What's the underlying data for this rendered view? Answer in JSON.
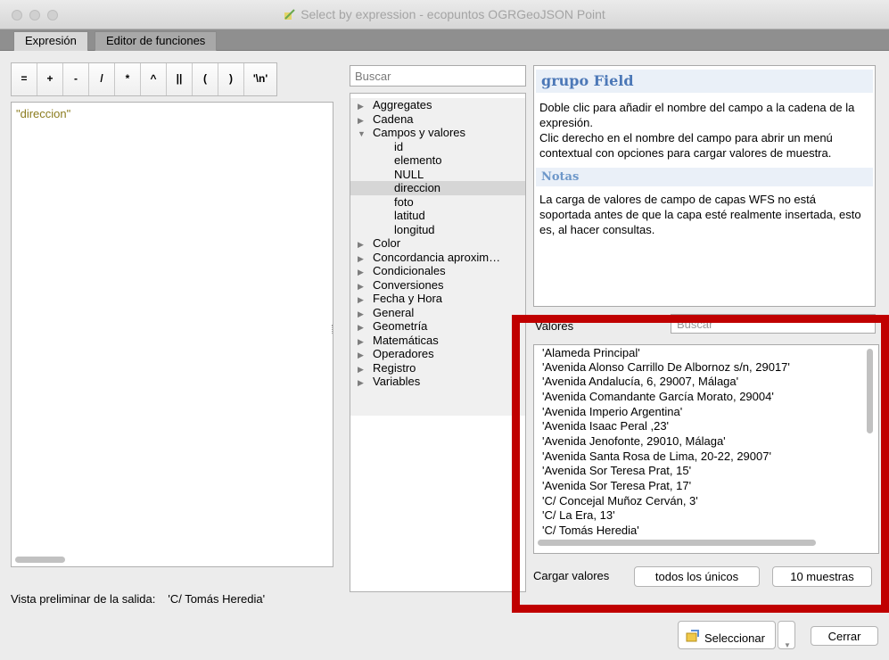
{
  "window": {
    "title": "Select by expression - ecopuntos OGRGeoJSON Point"
  },
  "tabs": [
    {
      "label": "Expresión"
    },
    {
      "label": "Editor de funciones"
    }
  ],
  "operators": [
    "=",
    "+",
    "-",
    "/",
    "*",
    "^",
    "||",
    "(",
    ")",
    "'\\n'"
  ],
  "editor": {
    "expression": "\"direccion\""
  },
  "preview": {
    "label": "Vista preliminar de la salida:",
    "value": "'C/ Tomás Heredia'"
  },
  "search": {
    "placeholder": "Buscar"
  },
  "tree": {
    "groups": [
      {
        "label": "Aggregates",
        "expanded": false
      },
      {
        "label": "Cadena",
        "expanded": false
      },
      {
        "label": "Campos y valores",
        "expanded": true,
        "children": [
          "id",
          "elemento",
          "NULL",
          "direccion",
          "foto",
          "latitud",
          "longitud"
        ],
        "selected_child": "direccion"
      },
      {
        "label": "Color",
        "expanded": false
      },
      {
        "label": "Concordancia aproxim…",
        "expanded": false
      },
      {
        "label": "Condicionales",
        "expanded": false
      },
      {
        "label": "Conversiones",
        "expanded": false
      },
      {
        "label": "Fecha y Hora",
        "expanded": false
      },
      {
        "label": "General",
        "expanded": false
      },
      {
        "label": "Geometría",
        "expanded": false
      },
      {
        "label": "Matemáticas",
        "expanded": false
      },
      {
        "label": "Operadores",
        "expanded": false
      },
      {
        "label": "Registro",
        "expanded": false
      },
      {
        "label": "Variables",
        "expanded": false
      }
    ]
  },
  "help": {
    "title": "grupo Field",
    "p1": "Doble clic para añadir el nombre del campo a la cadena de la expresión.",
    "p2": "Clic derecho en el nombre del campo para abrir un menú contextual con opciones para cargar valores de muestra.",
    "notes_title": "Notas",
    "notes": "La carga de valores de campo de capas WFS no está soportada antes de que la capa esté realmente insertada, esto es, al hacer consultas."
  },
  "values": {
    "label": "Valores",
    "search_placeholder": "Buscar",
    "items": [
      "'Alameda Principal'",
      "'Avenida Alonso Carrillo De Albornoz s/n, 29017'",
      "'Avenida Andalucía, 6, 29007, Málaga'",
      "'Avenida Comandante García Morato, 29004'",
      "'Avenida Imperio Argentina'",
      "'Avenida Isaac Peral ,23'",
      "'Avenida Jenofonte, 29010, Málaga'",
      "'Avenida Santa Rosa de Lima, 20-22, 29007'",
      "'Avenida Sor Teresa Prat, 15'",
      "'Avenida Sor Teresa Prat, 17'",
      "'C/ Concejal Muñoz Cerván, 3'",
      "'C/ La Era, 13'",
      "'C/ Tomás Heredia'"
    ],
    "load_label": "Cargar valores",
    "all_unique_label": "todos los únicos",
    "sample_label": "10 muestras"
  },
  "footer": {
    "select_label": "Seleccionar",
    "close_label": "Cerrar"
  },
  "colors": {
    "highlight": "#c00000",
    "help_title": "#4c78b7",
    "expression_text": "#8b7b1e"
  }
}
